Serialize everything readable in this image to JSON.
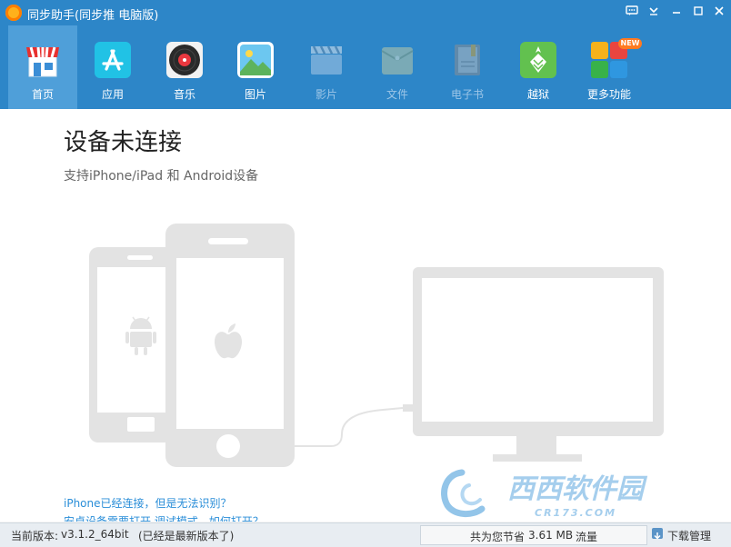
{
  "window": {
    "title": "同步助手(同步推 电脑版)",
    "icons": [
      "feedback-icon",
      "dropdown-icon",
      "minimize-icon",
      "maximize-icon",
      "close-icon"
    ]
  },
  "nav": {
    "items": [
      {
        "label": "首页",
        "icon": "store-icon",
        "active": true
      },
      {
        "label": "应用",
        "icon": "app-store-icon"
      },
      {
        "label": "音乐",
        "icon": "music-disc-icon"
      },
      {
        "label": "图片",
        "icon": "picture-icon"
      },
      {
        "label": "影片",
        "icon": "clapper-icon",
        "disabled": true
      },
      {
        "label": "文件",
        "icon": "folder-icon",
        "disabled": true
      },
      {
        "label": "电子书",
        "icon": "book-icon",
        "disabled": true
      },
      {
        "label": "越狱",
        "icon": "pineapple-icon"
      },
      {
        "label": "更多功能",
        "icon": "grid-icon",
        "badge": "NEW"
      }
    ],
    "colors": {
      "bar": "#2d86c8",
      "active": "#4f9fd9",
      "disabled_text": "#9dc6e7"
    }
  },
  "main": {
    "title": "设备未连接",
    "subtitle": "支持iPhone/iPad 和 Android设备",
    "links": [
      "iPhone已经连接，但是无法识别？",
      "安卓设备需要打开 调试模式，如何打开？"
    ]
  },
  "footer": {
    "version_label": "当前版本:",
    "version": "v3.1.2_64bit",
    "version_note": "(已经是最新版本了)",
    "saved_prefix": "共为您节省",
    "saved_amount": "3.61 MB",
    "saved_suffix": "流量",
    "download_label": "下载管理"
  },
  "watermark": {
    "text": "西西软件园",
    "domain": "CR173.COM"
  }
}
